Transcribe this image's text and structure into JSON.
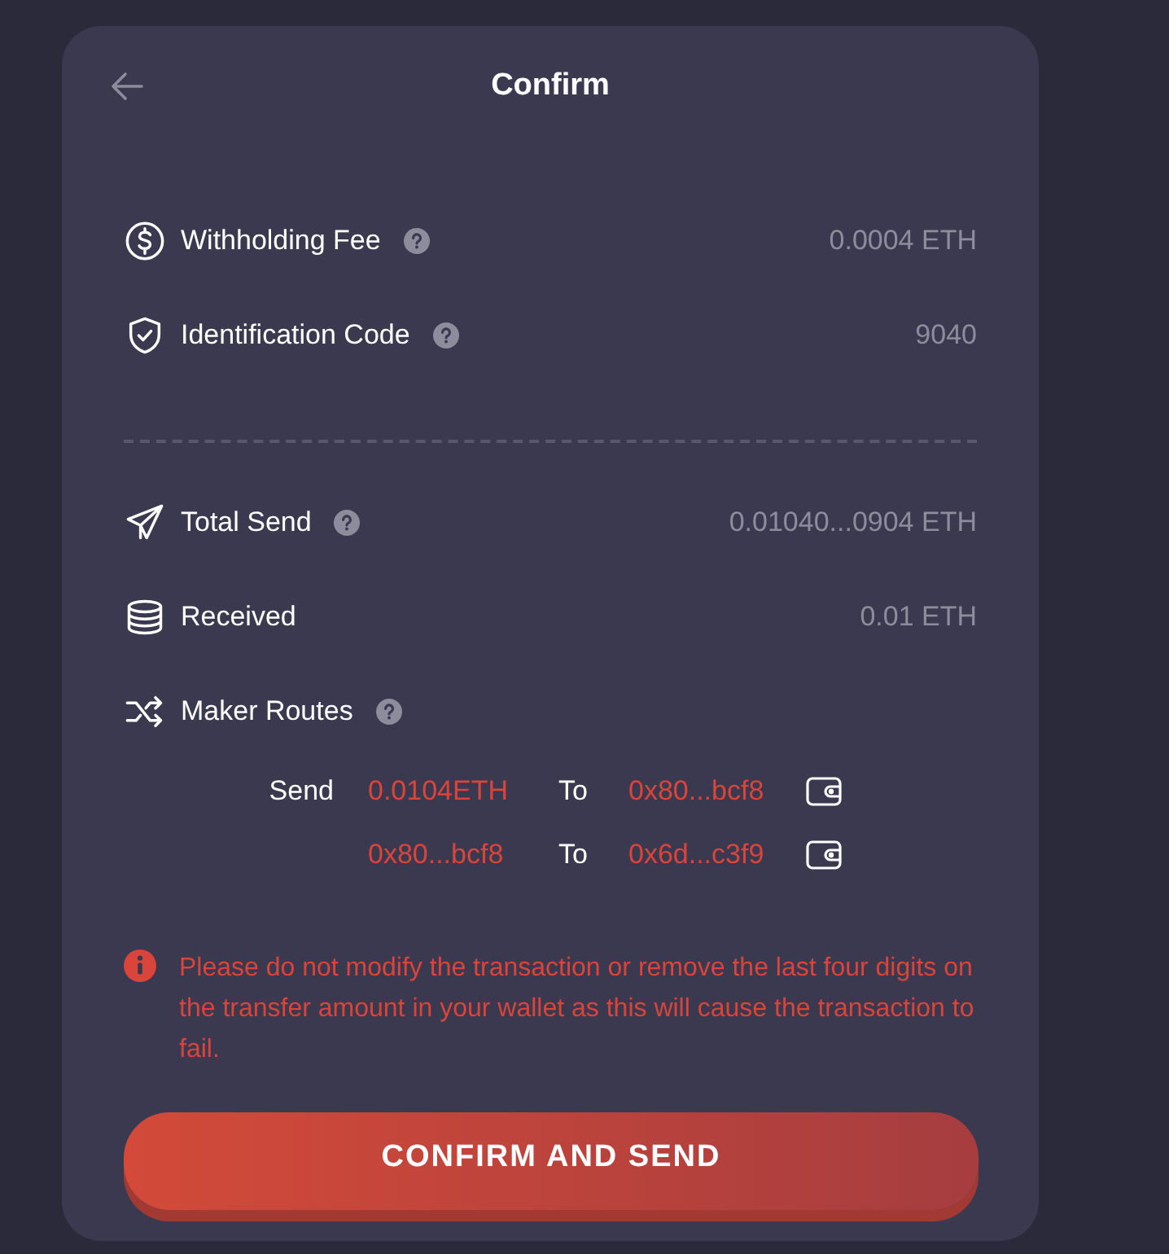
{
  "title": "Confirm",
  "sections": [
    [
      {
        "kind": "dollar",
        "label": "Withholding Fee",
        "help": true,
        "value": "0.0004 ETH"
      },
      {
        "kind": "shield",
        "label": "Identification Code",
        "help": true,
        "value": "9040"
      }
    ],
    [
      {
        "kind": "plane",
        "label": "Total Send",
        "help": true,
        "value": "0.01040...0904 ETH"
      },
      {
        "kind": "coins",
        "label": "Received",
        "help": false,
        "value": "0.01 ETH"
      },
      {
        "kind": "shuffle",
        "label": "Maker Routes",
        "help": true
      }
    ]
  ],
  "routes": [
    {
      "label": "Send",
      "from": "0.0104ETH",
      "joiner": "To",
      "to": "0x80...bcf8"
    },
    {
      "from": "0x80...bcf8",
      "joiner": "To",
      "to": "0x6d...c3f9"
    }
  ],
  "warning": "Please do not modify the transaction or remove the last four digits on the transfer amount in your wallet as this will cause the transaction to fail.",
  "button": "CONFIRM AND SEND"
}
